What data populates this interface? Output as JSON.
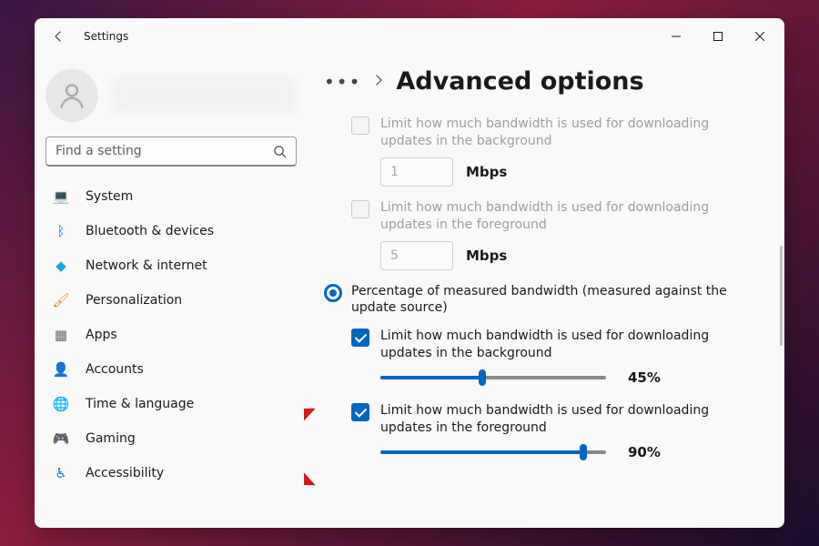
{
  "app_title": "Settings",
  "search": {
    "placeholder": "Find a setting"
  },
  "sidebar": {
    "items": [
      {
        "label": "System",
        "icon": "💻",
        "color": "#0078d4"
      },
      {
        "label": "Bluetooth & devices",
        "icon": "ᛒ",
        "color": "#0078d4"
      },
      {
        "label": "Network & internet",
        "icon": "◆",
        "color": "#1fa3e0"
      },
      {
        "label": "Personalization",
        "icon": "🖌",
        "color": "#d68a2a"
      },
      {
        "label": "Apps",
        "icon": "▦",
        "color": "#6a6a6a"
      },
      {
        "label": "Accounts",
        "icon": "👤",
        "color": "#2b9a4b"
      },
      {
        "label": "Time & language",
        "icon": "🌐",
        "color": "#2f87c5"
      },
      {
        "label": "Gaming",
        "icon": "🎮",
        "color": "#7a7a7a"
      },
      {
        "label": "Accessibility",
        "icon": "♿",
        "color": "#1f6fd0"
      }
    ]
  },
  "breadcrumb": {
    "page_title": "Advanced options"
  },
  "options": {
    "abs_bg": {
      "label": "Limit how much bandwidth is used for downloading updates in the background",
      "value": "1",
      "unit": "Mbps"
    },
    "abs_fg": {
      "label": "Limit how much bandwidth is used for downloading updates in the foreground",
      "value": "5",
      "unit": "Mbps"
    },
    "radio": {
      "label": "Percentage of measured bandwidth (measured against the update source)"
    },
    "pct_bg": {
      "label": "Limit how much bandwidth is used for downloading updates in the background",
      "pct": 45,
      "pct_text": "45%"
    },
    "pct_fg": {
      "label": "Limit how much bandwidth is used for downloading updates in the foreground",
      "pct": 90,
      "pct_text": "90%"
    }
  },
  "colors": {
    "accent": "#0067c0"
  }
}
